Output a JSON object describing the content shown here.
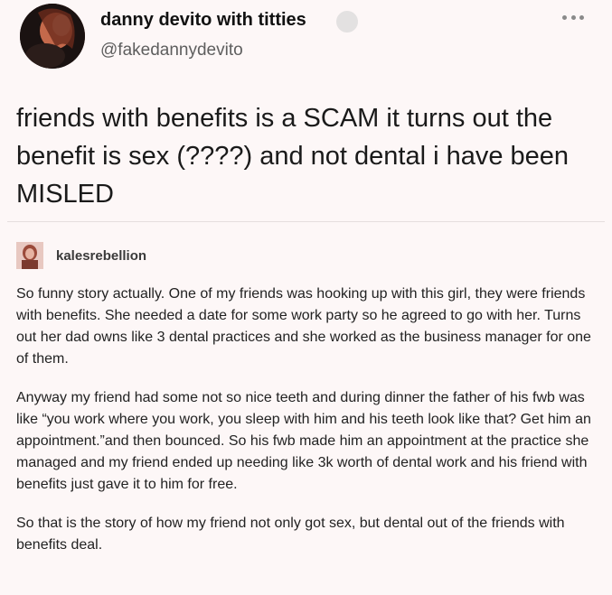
{
  "tweet": {
    "display_name": "danny devito with titties",
    "handle": "@fakedannydevito",
    "text": "friends with benefits is a SCAM it turns out the benefit is sex (????) and not dental i have been MISLED"
  },
  "reblog": {
    "username": "kalesrebellion",
    "paragraphs": [
      "So funny story actually. One of my friends was hooking up with this girl, they were friends with benefits. She needed a date for some work party so he agreed to go with her. Turns out her dad owns like 3 dental practices and she worked as the business manager for one of them.",
      "Anyway my friend had some not so nice teeth and during dinner the father of his fwb was like “you work where you work, you sleep with him and his teeth look like that? Get him an appointment.”and then bounced. So his fwb made him an appointment at the practice she managed and my friend ended up needing like 3k worth of dental work and his friend with benefits just gave it to him for free.",
      "So that is the story of how my friend not only got sex, but dental out of the friends with benefits deal."
    ]
  },
  "icons": {
    "more": "more-horizontal-icon",
    "verified": "verified-badge-icon"
  }
}
